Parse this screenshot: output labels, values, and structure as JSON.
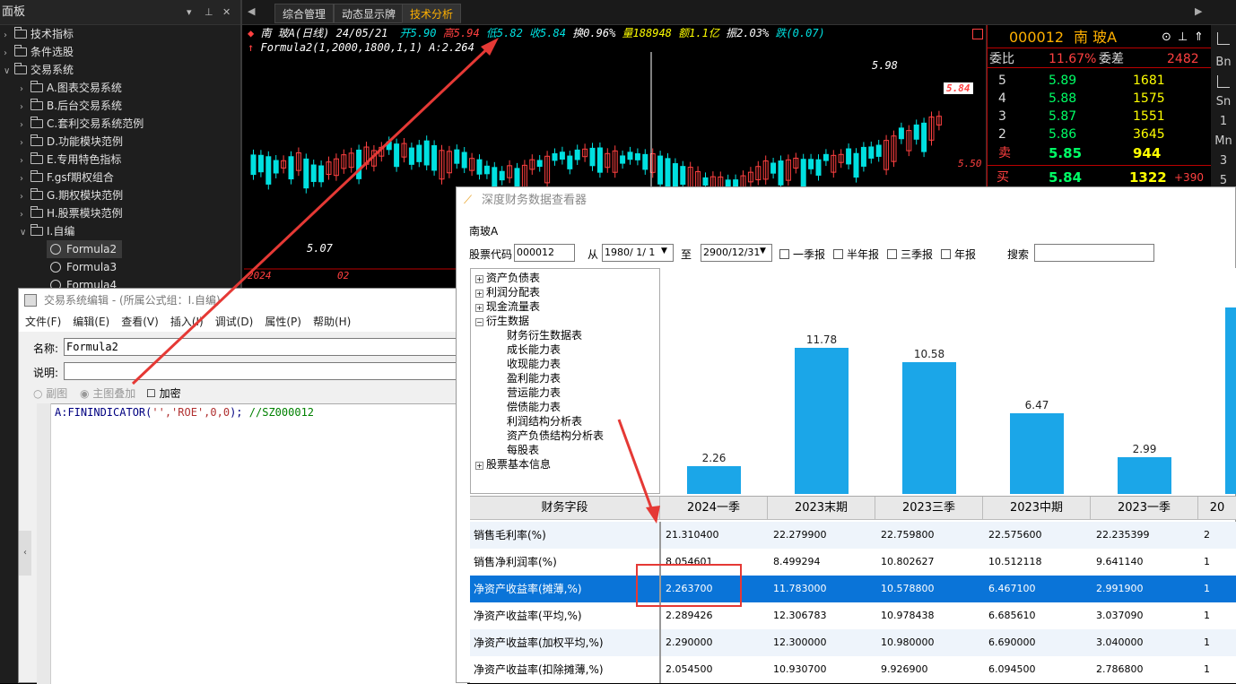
{
  "left_panel": {
    "title": "面板",
    "controls": [
      "▾",
      "⊥",
      "✕"
    ],
    "items": [
      {
        "label": "技术指标",
        "level": 0,
        "expanded": false
      },
      {
        "label": "条件选股",
        "level": 0,
        "expanded": false
      },
      {
        "label": "交易系统",
        "level": 0,
        "expanded": true
      },
      {
        "label": "A.图表交易系统",
        "level": 1,
        "expanded": false
      },
      {
        "label": "B.后台交易系统",
        "level": 1,
        "expanded": false
      },
      {
        "label": "C.套利交易系统范例",
        "level": 1,
        "expanded": false
      },
      {
        "label": "D.功能模块范例",
        "level": 1,
        "expanded": false
      },
      {
        "label": "E.专用特色指标",
        "level": 1,
        "expanded": false
      },
      {
        "label": "F.gsf期权组合",
        "level": 1,
        "expanded": false
      },
      {
        "label": "G.期权模块范例",
        "level": 1,
        "expanded": false
      },
      {
        "label": "H.股票模块范例",
        "level": 1,
        "expanded": false
      },
      {
        "label": "I.自编",
        "level": 1,
        "expanded": true
      },
      {
        "label": "Formula2",
        "level": 2,
        "selected": true
      },
      {
        "label": "Formula3",
        "level": 2
      },
      {
        "label": "Formula4",
        "level": 2
      }
    ]
  },
  "tabs": [
    {
      "label": "综合管理",
      "active": false
    },
    {
      "label": "动态显示牌",
      "active": false
    },
    {
      "label": "技术分析",
      "active": true
    }
  ],
  "chart": {
    "header": {
      "name": "南  玻A(日线) 24/05/21",
      "open": "开5.90",
      "high": "高5.94",
      "low": "低5.82",
      "close": "收5.84",
      "turnover": "换0.96%",
      "volume": "量188948",
      "amount": "额1.1亿",
      "amplitude": "振2.03%",
      "extra": "跌(0.07)"
    },
    "formula_line": "Formula2(1,2000,1800,1,1) A:2.264",
    "max_label": "5.98",
    "min_label": "5.07",
    "price_tag": "5.84",
    "price_axis": "5.50",
    "date_labels": [
      "2024",
      "02"
    ]
  },
  "quote": {
    "code": "000012",
    "name": "南  玻A",
    "wb_label": "委比",
    "wb_value": "11.67%",
    "wc_label": "委差",
    "wc_value": "2482",
    "asks": [
      {
        "level": "5",
        "price": "5.89",
        "vol": "1681"
      },
      {
        "level": "4",
        "price": "5.88",
        "vol": "1575"
      },
      {
        "level": "3",
        "price": "5.87",
        "vol": "1551"
      },
      {
        "level": "2",
        "price": "5.86",
        "vol": "3645"
      },
      {
        "level": "卖",
        "price": "5.85",
        "vol": "944"
      }
    ],
    "bid": {
      "level": "买",
      "price": "5.84",
      "vol": "1322",
      "chg": "+390"
    }
  },
  "right_strip": [
    "Bn",
    "Sn",
    "1",
    "Mn",
    "3",
    "5"
  ],
  "editor": {
    "title": "交易系统编辑 - (所属公式组：I.自编)",
    "menu": [
      "文件(F)",
      "编辑(E)",
      "查看(V)",
      "插入(I)",
      "调试(D)",
      "属性(P)",
      "帮助(H)"
    ],
    "name_label": "名称:",
    "name_value": "Formula2",
    "desc_label": "说明:",
    "desc_value": "",
    "opt_sub": "副图",
    "opt_main": "主图叠加",
    "opt_encrypt": "加密",
    "code_a": "A:FININDICATOR(",
    "code_args": "'','ROE',0,0",
    "code_end": ");",
    "code_comment": "//SZ000012"
  },
  "fin": {
    "title": "深度财务数据查看器",
    "stock_name": "南玻A",
    "code_label": "股票代码",
    "code_value": "000012",
    "from_label": "从",
    "from_value": "1980/ 1/ 1",
    "to_label": "至",
    "to_value": "2900/12/31",
    "checks": [
      "一季报",
      "半年报",
      "三季报",
      "年报"
    ],
    "search_label": "搜索",
    "search_value": "",
    "tree": [
      {
        "label": "资产负债表",
        "indent": 0,
        "plus": true
      },
      {
        "label": "利润分配表",
        "indent": 0,
        "plus": true
      },
      {
        "label": "现金流量表",
        "indent": 0,
        "plus": true
      },
      {
        "label": "衍生数据",
        "indent": 0,
        "plus": true,
        "open": true
      },
      {
        "label": "财务衍生数据表",
        "indent": 1
      },
      {
        "label": "成长能力表",
        "indent": 1
      },
      {
        "label": "收现能力表",
        "indent": 1
      },
      {
        "label": "盈利能力表",
        "indent": 1
      },
      {
        "label": "营运能力表",
        "indent": 1
      },
      {
        "label": "偿债能力表",
        "indent": 1
      },
      {
        "label": "利润结构分析表",
        "indent": 1
      },
      {
        "label": "资产负债结构分析表",
        "indent": 1
      },
      {
        "label": "每股表",
        "indent": 1
      },
      {
        "label": "股票基本信息",
        "indent": 0,
        "plus": true
      }
    ],
    "table_header": [
      "财务字段",
      "2024一季",
      "2023末期",
      "2023三季",
      "2023中期",
      "2023一季",
      "20"
    ],
    "rows": [
      {
        "field": "销售毛利率(%)",
        "vals": [
          "21.310400",
          "22.279900",
          "22.759800",
          "22.575600",
          "22.235399",
          "2"
        ]
      },
      {
        "field": "销售净利润率(%)",
        "vals": [
          "8.054601",
          "8.499294",
          "10.802627",
          "10.512118",
          "9.641140",
          "1"
        ]
      },
      {
        "field": "净资产收益率(摊薄,%)",
        "vals": [
          "2.263700",
          "11.783000",
          "10.578800",
          "6.467100",
          "2.991900",
          "1"
        ],
        "selected": true
      },
      {
        "field": "净资产收益率(平均,%)",
        "vals": [
          "2.289426",
          "12.306783",
          "10.978438",
          "6.685610",
          "3.037090",
          "1"
        ]
      },
      {
        "field": "净资产收益率(加权平均,%)",
        "vals": [
          "2.290000",
          "12.300000",
          "10.980000",
          "6.690000",
          "3.040000",
          "1"
        ]
      },
      {
        "field": "净资产收益率(扣除摊薄,%)",
        "vals": [
          "2.054500",
          "10.930700",
          "9.926900",
          "6.094500",
          "2.786800",
          "1"
        ]
      }
    ]
  },
  "chart_data": {
    "type": "bar",
    "categories": [
      "2024一季",
      "2023末期",
      "2023三季",
      "2023中期",
      "2023一季",
      "20"
    ],
    "values": [
      2.26,
      11.78,
      10.58,
      6.47,
      2.99,
      15
    ],
    "ylim": [
      0,
      16
    ]
  },
  "colors": {
    "accent": "#1ba6e8",
    "up": "#ff4040",
    "down": "#00e0e0",
    "highlight": "#0a74d8",
    "annot": "#e53935"
  }
}
